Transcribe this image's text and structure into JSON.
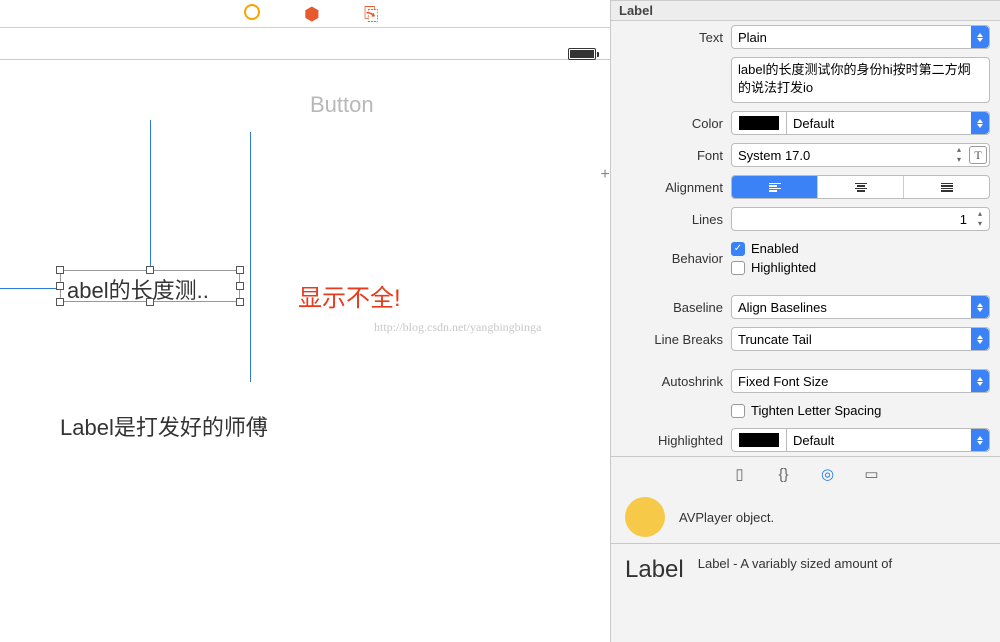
{
  "inspector_title": "Label",
  "text_row": {
    "label": "Text",
    "mode": "Plain",
    "content": "label的长度测试你的身份hi按时第二方炯的说法打发io"
  },
  "color_row": {
    "label": "Color",
    "value": "Default"
  },
  "font_row": {
    "label": "Font",
    "value": "System 17.0"
  },
  "alignment_row": {
    "label": "Alignment"
  },
  "lines_row": {
    "label": "Lines",
    "value": "1"
  },
  "behavior_row": {
    "label": "Behavior",
    "enabled": "Enabled",
    "highlighted": "Highlighted"
  },
  "baseline_row": {
    "label": "Baseline",
    "value": "Align Baselines"
  },
  "linebreaks_row": {
    "label": "Line Breaks",
    "value": "Truncate Tail"
  },
  "autoshrink_row": {
    "label": "Autoshrink",
    "value": "Fixed Font Size",
    "tighten": "Tighten Letter Spacing"
  },
  "highlighted_row": {
    "label": "Highlighted",
    "value": "Default"
  },
  "library": {
    "avplayer": "AVPlayer object.",
    "label_title": "Label",
    "label_desc": "Label - A variably sized amount of"
  },
  "canvas": {
    "button": "Button",
    "truncated_label": "abel的长度测..",
    "red_note": "显示不全!",
    "other_label": "Label是打发好的师傅",
    "watermark": "http://blog.csdn.net/yangbingbinga"
  }
}
